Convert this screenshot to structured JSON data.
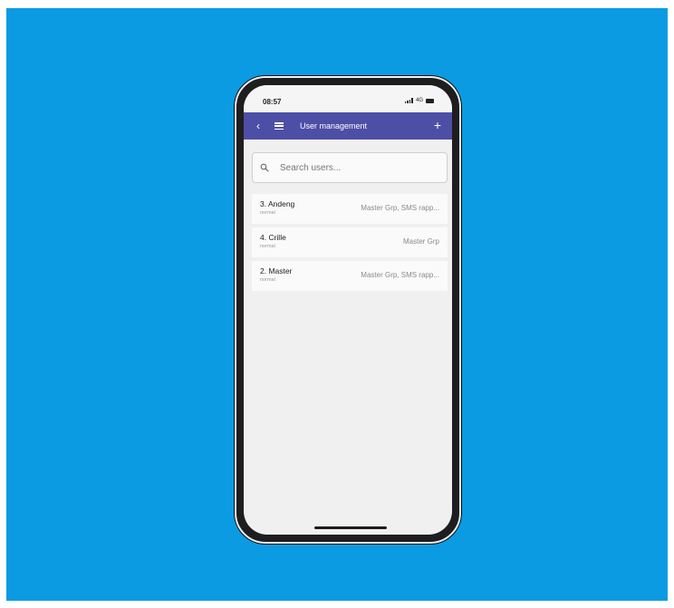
{
  "colors": {
    "background": "#0a9be3",
    "app_bar": "#4d4fa6",
    "screen": "#f0f0f0"
  },
  "status_bar": {
    "time": "08:57",
    "network": "4G",
    "icons": [
      "signal-icon",
      "battery-icon"
    ]
  },
  "app_bar": {
    "title": "User management",
    "back_icon": "chevron-left-icon",
    "menu_icon": "hamburger-icon",
    "add_icon": "plus-icon"
  },
  "search": {
    "placeholder": "Search users...",
    "value": "",
    "icon": "search-icon"
  },
  "users": [
    {
      "name": "3. Andeng",
      "role": "normal",
      "groups": "Master Grp, SMS rapp..."
    },
    {
      "name": "4. Crille",
      "role": "normal",
      "groups": "Master Grp"
    },
    {
      "name": "2. Master",
      "role": "normal",
      "groups": "Master Grp, SMS rapp..."
    }
  ]
}
